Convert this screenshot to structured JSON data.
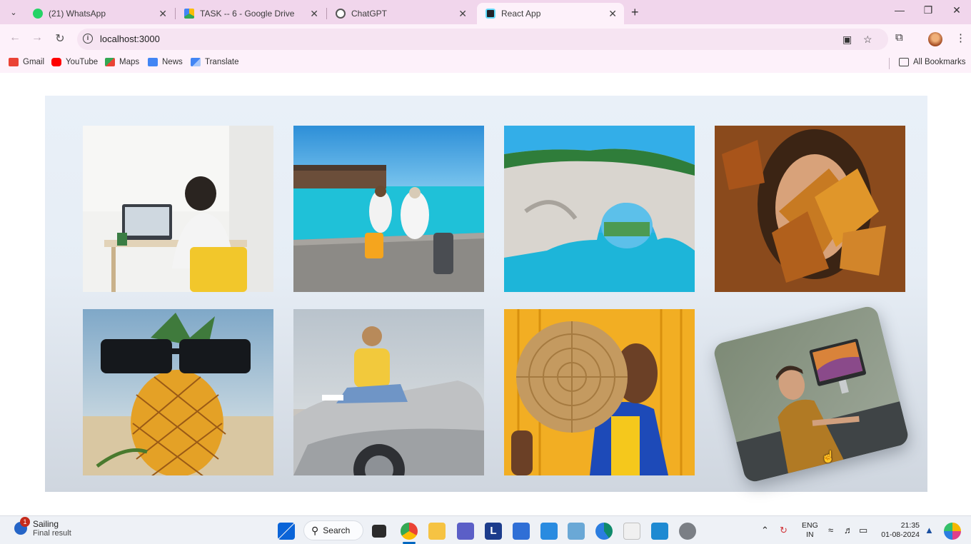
{
  "browser": {
    "tabs": [
      {
        "label": "(21) WhatsApp",
        "color": "#25d366"
      },
      {
        "label": "TASK -- 6 - Google Drive",
        "color": "#fbbc04"
      },
      {
        "label": "ChatGPT",
        "color": "#555555"
      },
      {
        "label": "React App",
        "color": "#20232a"
      }
    ],
    "active_tab": "React App",
    "url": "localhost:3000",
    "bookmarks": [
      {
        "label": "Gmail",
        "color": "#ea4335"
      },
      {
        "label": "YouTube",
        "color": "#ff0000"
      },
      {
        "label": "Maps",
        "color": "#34a853"
      },
      {
        "label": "News",
        "color": "#4285f4"
      },
      {
        "label": "Translate",
        "color": "#4285f4"
      }
    ],
    "all_bookmarks_label": "All Bookmarks"
  },
  "gallery": {
    "photos": [
      {
        "subject": "person-working-at-laptop"
      },
      {
        "subject": "couple-with-suitcases-on-pier"
      },
      {
        "subject": "sea-rock-arch"
      },
      {
        "subject": "woman-with-autumn-leaves"
      },
      {
        "subject": "pineapple-with-sunglasses"
      },
      {
        "subject": "woman-sitting-on-convertible"
      },
      {
        "subject": "woman-holding-woven-hat"
      },
      {
        "subject": "man-at-desk-with-computer",
        "hovered": true
      }
    ]
  },
  "taskbar": {
    "weather_title": "Sailing",
    "weather_subtitle": "Final result",
    "notification_count": "1",
    "search_label": "Search",
    "language_line1": "ENG",
    "language_line2": "IN",
    "time": "21:35",
    "date": "01-08-2024"
  }
}
